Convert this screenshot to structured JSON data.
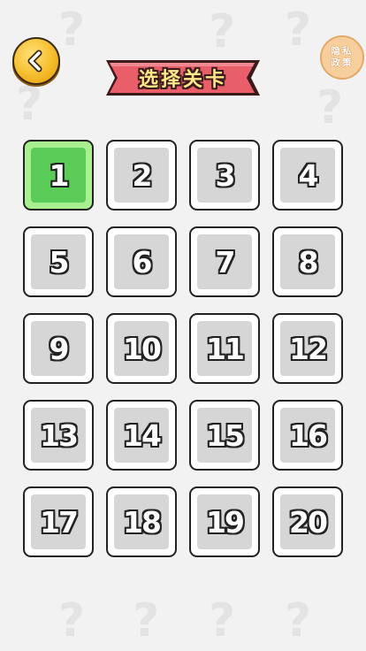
{
  "header": {
    "title": "选择关卡",
    "back_icon": "chevron-left-icon",
    "privacy_label": "隐私政策"
  },
  "levels": [
    {
      "label": "1",
      "unlocked": true
    },
    {
      "label": "2",
      "unlocked": false
    },
    {
      "label": "3",
      "unlocked": false
    },
    {
      "label": "4",
      "unlocked": false
    },
    {
      "label": "5",
      "unlocked": false
    },
    {
      "label": "6",
      "unlocked": false
    },
    {
      "label": "7",
      "unlocked": false
    },
    {
      "label": "8",
      "unlocked": false
    },
    {
      "label": "9",
      "unlocked": false
    },
    {
      "label": "10",
      "unlocked": false
    },
    {
      "label": "11",
      "unlocked": false
    },
    {
      "label": "12",
      "unlocked": false
    },
    {
      "label": "13",
      "unlocked": false
    },
    {
      "label": "14",
      "unlocked": false
    },
    {
      "label": "15",
      "unlocked": false
    },
    {
      "label": "16",
      "unlocked": false
    },
    {
      "label": "17",
      "unlocked": false
    },
    {
      "label": "18",
      "unlocked": false
    },
    {
      "label": "19",
      "unlocked": false
    },
    {
      "label": "20",
      "unlocked": false
    }
  ],
  "colors": {
    "unlocked_fill": "#5ccc58",
    "unlocked_frame": "#a8f08f",
    "locked_fill": "#d6d6d6",
    "ribbon": "#e85f6a",
    "back_button": "#f5bd2b"
  }
}
